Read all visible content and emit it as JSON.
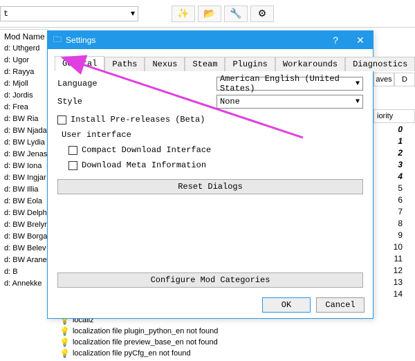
{
  "bg": {
    "combo_value": "t",
    "col_header": "Mod Name",
    "rows": [
      "d: Uthgerd",
      "d: Ugor",
      "d: Rayya",
      "d: Mjoll",
      "d: Jordis",
      "d: Frea",
      "d: BW Ria",
      "d: BW Njada",
      "d: BW Lydia",
      "d: BW Jenas",
      "d: BW Iona",
      "d: BW Ingjar",
      "d: BW Illia",
      "d: BW Eola",
      "d: BW Delph",
      "d: BW Brelyn",
      "d: BW Borga",
      "d: BW Belev",
      "d: BW Arane",
      "d: B",
      "d: Annekke",
      " "
    ],
    "right_head1a": "aves",
    "right_head1b": "D",
    "right_head2": "iority",
    "right_nums": [
      "0",
      "1",
      "2",
      "3",
      "4",
      "5",
      "6",
      "7",
      "8",
      "9",
      "10",
      "11",
      "12",
      "13",
      "14"
    ],
    "status": [
      "localiz",
      "localization file plugin_python_en not found",
      "localization file preview_base_en not found",
      "localization file pyCfg_en not found"
    ]
  },
  "dlg": {
    "title": "Settings",
    "tabs": [
      "General",
      "Paths",
      "Nexus",
      "Steam",
      "Plugins",
      "Workarounds",
      "Diagnostics"
    ],
    "lang_label": "Language",
    "lang_value": "American English (United States)",
    "style_label": "Style",
    "style_value": "None",
    "prerelease_label": "Install Pre-releases (Beta)",
    "ui_group": "User interface",
    "compact_label": "Compact Download Interface",
    "meta_label": "Download Meta Information",
    "reset_btn": "Reset Dialogs",
    "config_btn": "Configure Mod Categories",
    "ok": "OK",
    "cancel": "Cancel"
  }
}
